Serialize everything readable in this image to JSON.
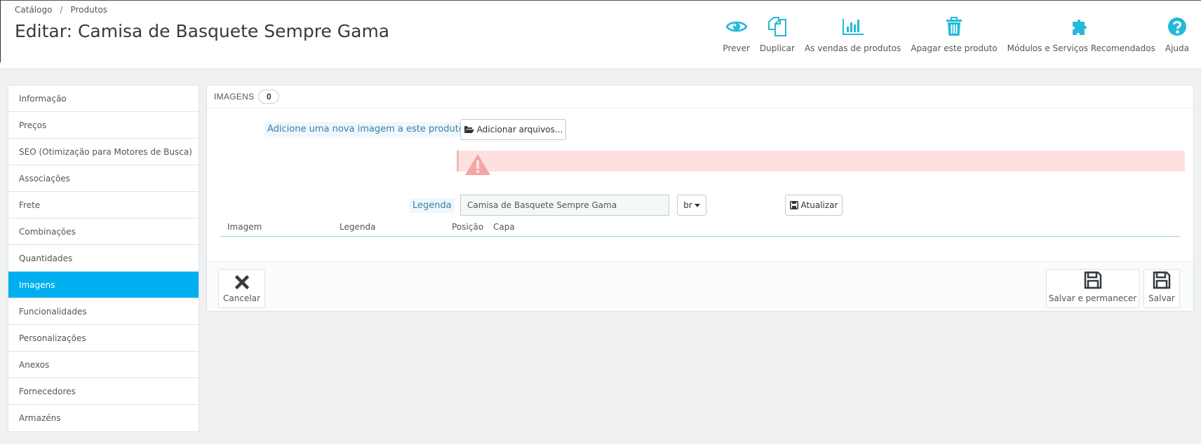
{
  "breadcrumb": {
    "item1": "Catálogo",
    "separator": "/",
    "item2": "Produtos"
  },
  "page_title": "Editar: Camisa de Basquete Sempre Gama",
  "toolbar": [
    {
      "label": "Prever",
      "icon": "eye-icon"
    },
    {
      "label": "Duplicar",
      "icon": "copy-icon"
    },
    {
      "label": "As vendas de produtos",
      "icon": "bar-chart-icon"
    },
    {
      "label": "Apagar este produto",
      "icon": "trash-icon"
    },
    {
      "label": "Módulos e Serviços Recomendados",
      "icon": "puzzle-icon"
    },
    {
      "label": "Ajuda",
      "icon": "help-icon"
    }
  ],
  "sidebar": {
    "active_index": 7,
    "items": [
      {
        "label": "Informação"
      },
      {
        "label": "Preços"
      },
      {
        "label": "SEO (Otimização para Motores de Busca)"
      },
      {
        "label": "Associações"
      },
      {
        "label": "Frete"
      },
      {
        "label": "Combinações"
      },
      {
        "label": "Quantidades"
      },
      {
        "label": "Imagens"
      },
      {
        "label": "Funcionalidades"
      },
      {
        "label": "Personalizações"
      },
      {
        "label": "Anexos"
      },
      {
        "label": "Fornecedores"
      },
      {
        "label": "Armazéns"
      }
    ]
  },
  "panel": {
    "heading": "Imagens",
    "count": "0",
    "add_image_label": "Adicione uma nova imagem a este produto",
    "add_files_button": "Adicionar arquivos...",
    "caption_label": "Legenda",
    "caption_value": "Camisa de Basquete Sempre Gama",
    "language": "br",
    "update_button": "Atualizar",
    "table_headers": {
      "image": "Imagem",
      "caption": "Legenda",
      "position": "Posição",
      "cover": "Capa"
    },
    "colors": {
      "accent": "#00aff0",
      "alert_bg": "#fde1e1",
      "icon": "#25b9d7"
    }
  },
  "footer": {
    "cancel": "Cancelar",
    "save_stay": "Salvar e permanecer",
    "save": "Salvar"
  }
}
